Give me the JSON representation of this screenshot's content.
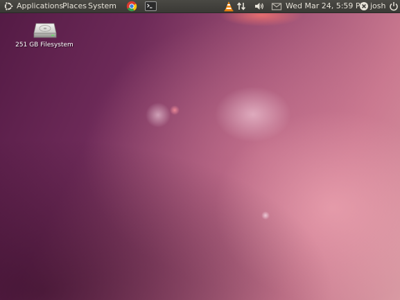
{
  "top_panel": {
    "menus": {
      "applications": "Applications",
      "places": "Places",
      "system": "System"
    },
    "launchers": [
      "chrome-icon",
      "terminal-icon"
    ],
    "indicators": [
      "vlc-icon",
      "network-icon",
      "volume-icon",
      "mail-icon"
    ],
    "clock": "Wed Mar 24,  5:59 PM",
    "user": "josh",
    "session_icon": "power-icon"
  },
  "desktop": {
    "icons": [
      {
        "label": "251 GB Filesystem",
        "icon": "hard-drive-icon"
      }
    ]
  },
  "colors": {
    "panel": "#3c3b37",
    "panel_text": "#dfdbd2",
    "wallpaper_dark": "#531a44",
    "wallpaper_light": "#d99aa3",
    "vlc_orange": "#f08c1a"
  }
}
